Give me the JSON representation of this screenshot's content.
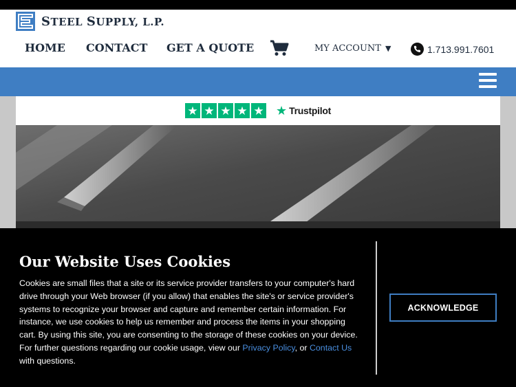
{
  "site": {
    "logo_icon": "steel-supply-logo-mark",
    "name_parts": {
      "s1": "S",
      "w1": "TEEL ",
      "s2": "S",
      "w2": "UPPLY, L.P."
    }
  },
  "nav": {
    "home": "HOME",
    "contact": "CONTACT",
    "quote": "GET A QUOTE",
    "cart_icon": "shopping-cart-icon",
    "account": "MY ACCOUNT",
    "account_caret": "▼",
    "phone": "1.713.991.7601",
    "phone_icon": "phone-icon"
  },
  "menu_icon": "hamburger-menu-icon",
  "trustpilot": {
    "rating_stars": 5,
    "label": "Trustpilot"
  },
  "cookie": {
    "title": "Our Website Uses Cookies",
    "body": "Cookies are small files that a site or its service provider transfers to your computer's hard drive through your Web browser (if you allow) that enables the site's or service provider's systems to recognize your browser and capture and remember certain information. For instance, we use cookies to help us remember and process the items in your shopping cart. By using this site, you are consenting to the storage of these cookies on your device. For further questions regarding our cookie usage, view our ",
    "privacy_link": "Privacy Policy",
    "sep": ", or ",
    "contact_link": "Contact Us",
    "tail": " with questions.",
    "button": "ACKNOWLEDGE"
  },
  "colors": {
    "brand_blue": "#3f7ec3",
    "navy": "#1f2c3d",
    "trustpilot_green": "#00b67a"
  }
}
